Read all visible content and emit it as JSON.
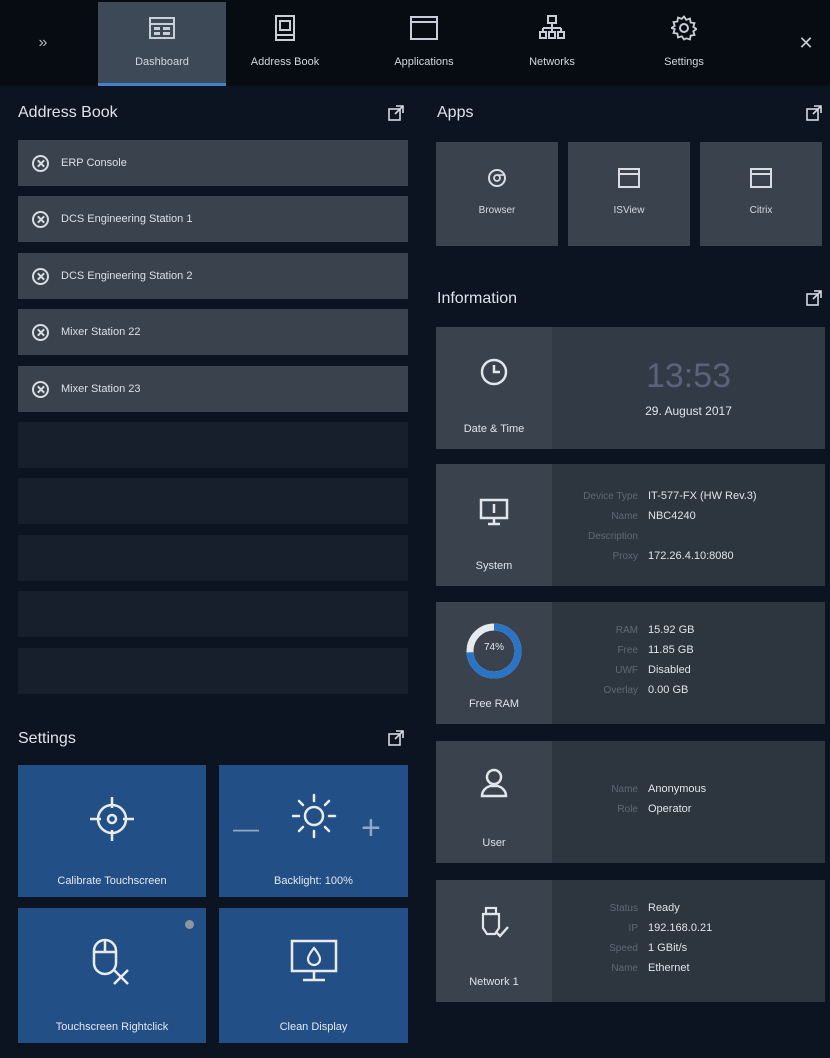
{
  "topbar": {
    "tabs": [
      {
        "label": "Dashboard",
        "active": true,
        "icon": "dashboard-icon"
      },
      {
        "label": "Address Book",
        "active": false,
        "icon": "address-book-icon"
      },
      {
        "label": "Applications",
        "active": false,
        "icon": "window-icon"
      },
      {
        "label": "Networks",
        "active": false,
        "icon": "network-icon"
      },
      {
        "label": "Settings",
        "active": false,
        "icon": "gear-icon"
      }
    ],
    "expand_icon": "double-chevron-right-icon",
    "close_icon": "close-icon"
  },
  "address_book": {
    "title": "Address Book",
    "entries": [
      "ERP Console",
      "DCS Engineering Station 1",
      "DCS Engineering Station 2",
      "Mixer Station 22",
      "Mixer Station 23"
    ],
    "empty_slots": 5
  },
  "settings": {
    "title": "Settings",
    "tiles": [
      {
        "label": "Calibrate Touchscreen",
        "icon": "crosshair-icon"
      },
      {
        "label": "Backlight: 100%",
        "icon": "sun-icon",
        "minus": "—",
        "plus": "+"
      },
      {
        "label": "Touchscreen Rightclick",
        "icon": "mouse-cancel-icon"
      },
      {
        "label": "Clean Display",
        "icon": "monitor-drop-icon"
      }
    ]
  },
  "apps": {
    "title": "Apps",
    "items": [
      {
        "label": "Browser",
        "icon": "browser-icon"
      },
      {
        "label": "ISView",
        "icon": "window-icon"
      },
      {
        "label": "Citrix",
        "icon": "window-icon"
      }
    ]
  },
  "information": {
    "title": "Information",
    "datetime": {
      "label": "Date & Time",
      "time": "13:53",
      "date": "29. August 2017"
    },
    "system": {
      "label": "System",
      "rows": [
        {
          "k": "Device Type",
          "v": "IT-577-FX (HW Rev.3)"
        },
        {
          "k": "Name",
          "v": "NBC4240"
        },
        {
          "k": "Description",
          "v": ""
        },
        {
          "k": "Proxy",
          "v": "172.26.4.10:8080"
        }
      ]
    },
    "ram": {
      "label": "Free RAM",
      "percent_text": "74%",
      "percent": 0.74,
      "rows": [
        {
          "k": "RAM",
          "v": "15.92 GB"
        },
        {
          "k": "Free",
          "v": "11.85 GB"
        },
        {
          "k": "UWF",
          "v": "Disabled"
        },
        {
          "k": "Overlay",
          "v": "0.00 GB"
        }
      ]
    },
    "user": {
      "label": "User",
      "rows": [
        {
          "k": "Name",
          "v": "Anonymous"
        },
        {
          "k": "Role",
          "v": "Operator"
        }
      ]
    },
    "network": {
      "label": "Network 1",
      "rows": [
        {
          "k": "Status",
          "v": "Ready"
        },
        {
          "k": "IP",
          "v": "192.168.0.21"
        },
        {
          "k": "Speed",
          "v": "1 GBit/s"
        },
        {
          "k": "Name",
          "v": "Ethernet"
        }
      ]
    }
  },
  "colors": {
    "accent": "#3f82ce",
    "tile_blue": "#224f86",
    "panel": "#39424d",
    "background": "#0c1421"
  }
}
